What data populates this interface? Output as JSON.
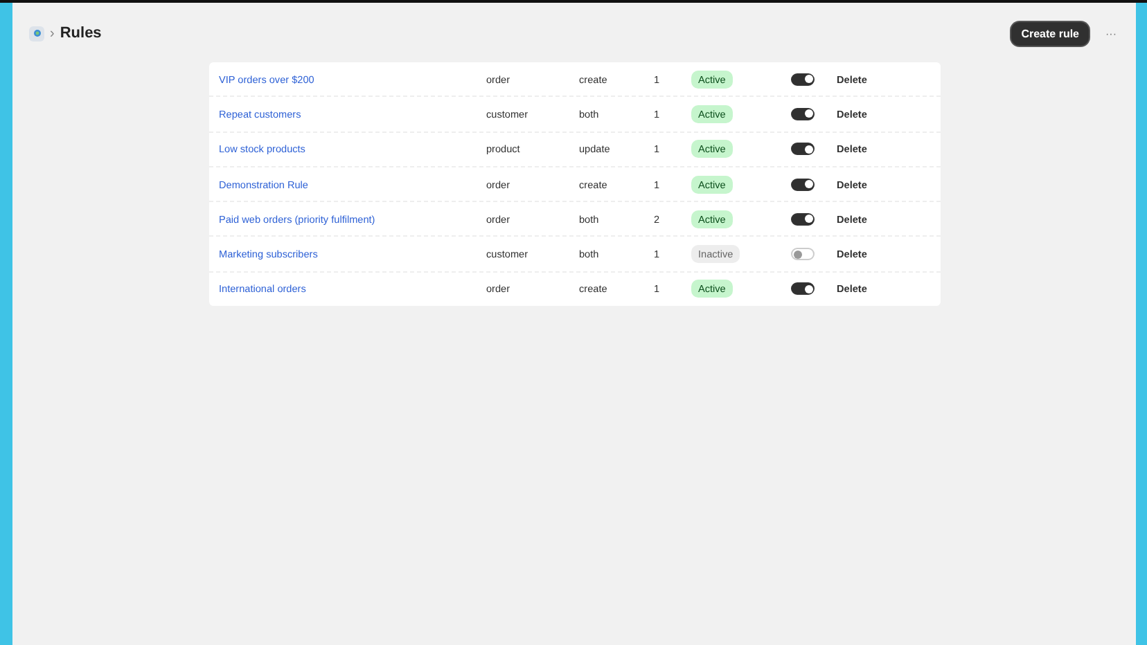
{
  "header": {
    "breadcrumb_separator": "›",
    "title": "Rules",
    "create_button": "Create rule",
    "more_button": "···"
  },
  "rules": [
    {
      "name": "VIP orders over $200",
      "resource": "order",
      "trigger": "create",
      "count": "1",
      "status": "Active",
      "active": true,
      "on": true,
      "action": "Delete"
    },
    {
      "name": "Repeat customers",
      "resource": "customer",
      "trigger": "both",
      "count": "1",
      "status": "Active",
      "active": true,
      "on": true,
      "action": "Delete"
    },
    {
      "name": "Low stock products",
      "resource": "product",
      "trigger": "update",
      "count": "1",
      "status": "Active",
      "active": true,
      "on": true,
      "action": "Delete"
    },
    {
      "name": "Demonstration Rule",
      "resource": "order",
      "trigger": "create",
      "count": "1",
      "status": "Active",
      "active": true,
      "on": true,
      "action": "Delete"
    },
    {
      "name": "Paid web orders (priority fulfilment)",
      "resource": "order",
      "trigger": "both",
      "count": "2",
      "status": "Active",
      "active": true,
      "on": true,
      "action": "Delete"
    },
    {
      "name": "Marketing subscribers",
      "resource": "customer",
      "trigger": "both",
      "count": "1",
      "status": "Inactive",
      "active": false,
      "on": false,
      "action": "Delete"
    },
    {
      "name": "International orders",
      "resource": "order",
      "trigger": "create",
      "count": "1",
      "status": "Active",
      "active": true,
      "on": true,
      "action": "Delete"
    }
  ]
}
